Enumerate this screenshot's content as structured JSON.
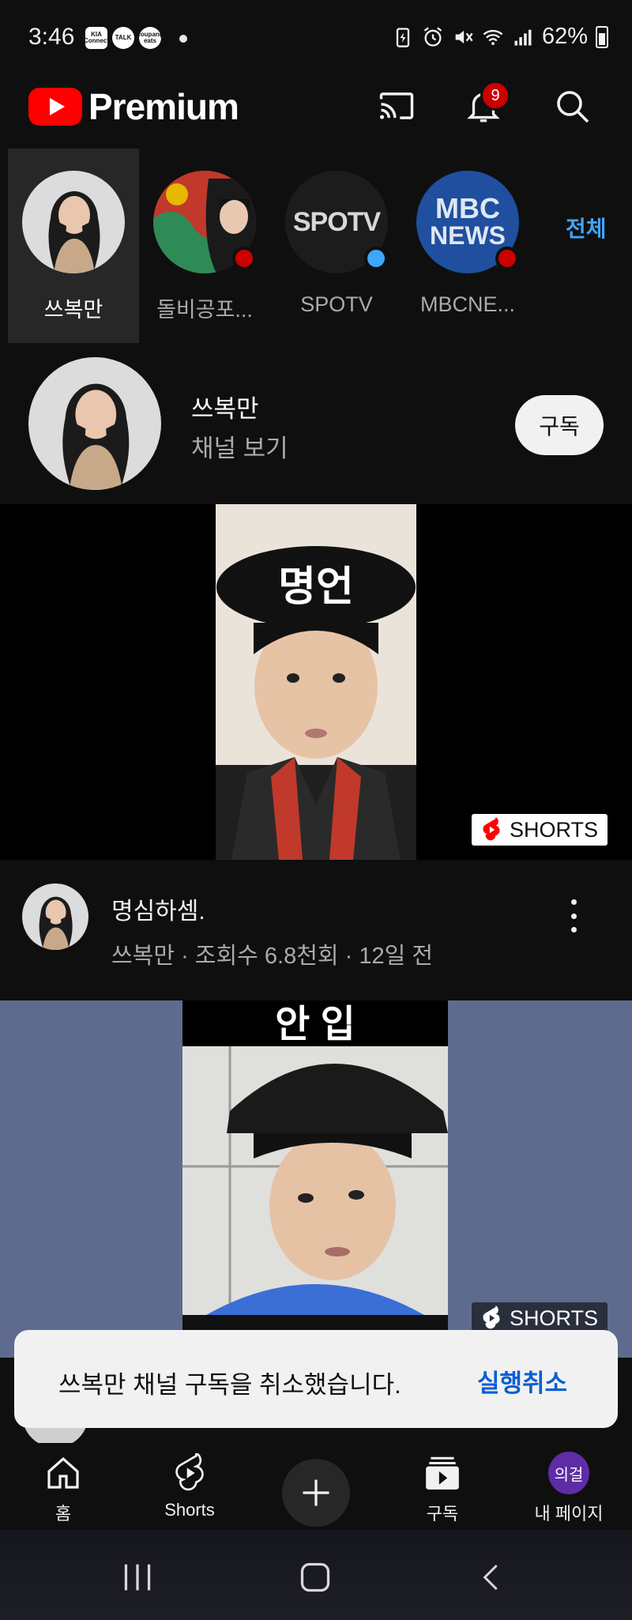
{
  "status_bar": {
    "time": "3:46",
    "app_icons": [
      {
        "name": "kia-connect",
        "label": "KIA Connect"
      },
      {
        "name": "kakaotalk",
        "label": "TALK"
      },
      {
        "name": "coupang-eats",
        "label": "coupang eats"
      }
    ],
    "battery": "62%"
  },
  "header": {
    "brand": "Premium",
    "notification_count": "9"
  },
  "channels": {
    "items": [
      {
        "name": "쓰복만",
        "selected": true
      },
      {
        "name": "돌비공포...",
        "selected": false,
        "dot_color": "#cc0000"
      },
      {
        "name": "SPOTV",
        "selected": false,
        "dot_color": "#3ea6ff"
      },
      {
        "name": "MBCNE...",
        "selected": false,
        "dot_color": "#cc0000"
      }
    ],
    "see_all": "전체",
    "logo_texts": {
      "spotv": "SPOTV",
      "mbc_top": "MBC",
      "mbc_bottom": "NEWS"
    }
  },
  "channel_header": {
    "name": "쓰복만",
    "link": "채널 보기",
    "subscribe_label": "구독"
  },
  "videos": [
    {
      "thumb_caption": "명언",
      "badge": "SHORTS",
      "title": "명심하셈.",
      "subtitle": "쓰복만 · 조회수 6.8천회 · 12일 전"
    },
    {
      "thumb_caption": "안 입",
      "badge": "SHORTS"
    }
  ],
  "toast": {
    "message": "쓰복만 채널 구독을 취소했습니다.",
    "action": "실행취소"
  },
  "bottom_nav": {
    "home": "홈",
    "shorts": "Shorts",
    "subscriptions": "구독",
    "me": "내 페이지",
    "me_avatar_text": "의걸"
  },
  "colors": {
    "background": "#0f0f0f",
    "brand_red": "#ff0000",
    "link_blue": "#3ea6ff",
    "toast_action": "#065fd4"
  }
}
